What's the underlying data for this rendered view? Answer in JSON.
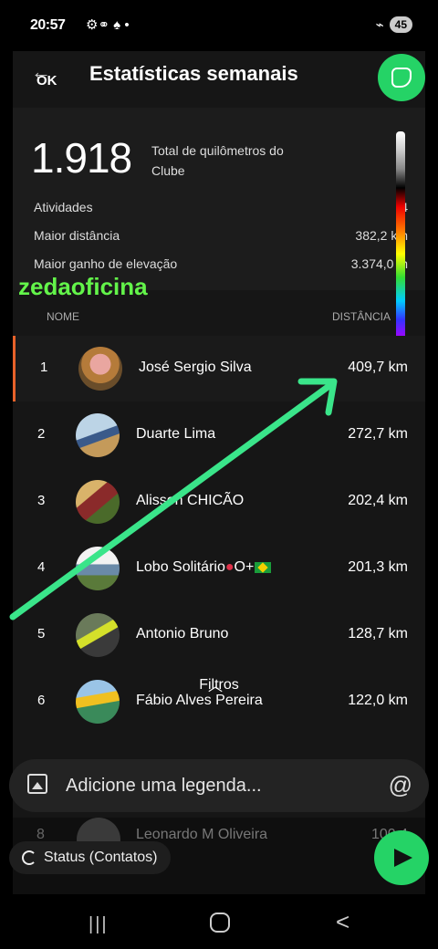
{
  "status_bar": {
    "time": "20:57",
    "icons": "⚙⚭ ♠ •",
    "wifi": "⌁",
    "battery": "45"
  },
  "header": {
    "back_label": "OK",
    "title": "Estatísticas semanais"
  },
  "summary": {
    "total_value": "1.918",
    "total_label": "Total de quilômetros do Clube",
    "rows": [
      {
        "label": "Atividades",
        "value": "4"
      },
      {
        "label": "Maior distância",
        "value": "382,2 km"
      },
      {
        "label": "Maior ganho de elevação",
        "value": "3.374,0 m"
      }
    ]
  },
  "watermark": "zedaoficina",
  "list": {
    "col_name": "NOME",
    "col_distance": "DISTÂNCIA",
    "rows": [
      {
        "rank": "1",
        "name": "José Sergio Silva",
        "distance": "409,7 km"
      },
      {
        "rank": "2",
        "name": "Duarte Lima",
        "distance": "272,7 km"
      },
      {
        "rank": "3",
        "name": "Alisson CHICÃO",
        "distance": "202,4 km"
      },
      {
        "rank": "4",
        "name": "Lobo Solitário",
        "name_suffix": "O+",
        "distance": "201,3 km"
      },
      {
        "rank": "5",
        "name": "Antonio Bruno",
        "distance": "128,7 km"
      },
      {
        "rank": "6",
        "name": "Fábio Alves Pereira",
        "distance": "122,0 km"
      }
    ],
    "hidden_row": {
      "rank": "8",
      "name": "Leonardo M Oliveira",
      "distance": "100,4"
    }
  },
  "filters_label": "Filtros",
  "caption": {
    "placeholder": "Adicione uma legenda..."
  },
  "status_chip": {
    "label": "Status (Contatos)"
  },
  "colors": {
    "accent_green": "#25d366",
    "rank1_bar": "#e8622a",
    "watermark": "#63f44a"
  }
}
